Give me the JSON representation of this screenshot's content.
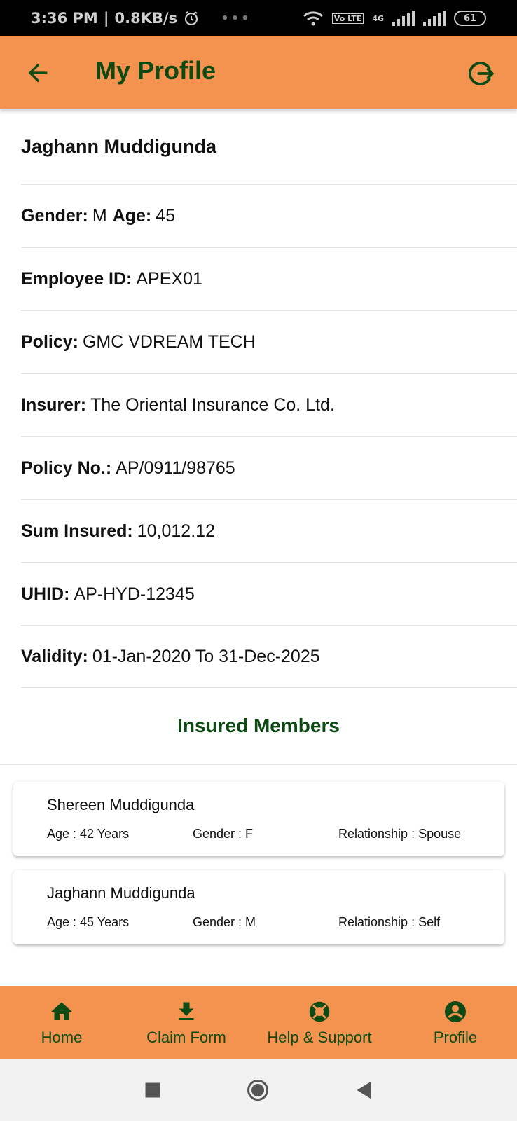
{
  "status_bar": {
    "time": "3:36 PM",
    "speed": "0.8KB/s",
    "network_tags": [
      "Vo LTE",
      "4G"
    ],
    "battery": "61"
  },
  "header": {
    "title": "My Profile",
    "back_icon": "back-arrow-icon",
    "logout_icon": "logout-icon"
  },
  "profile": {
    "name": "Jaghann Muddigunda",
    "gender_label": "Gender:",
    "gender_value": "M",
    "age_label": "Age:",
    "age_value": "45",
    "employee_id_label": "Employee ID:",
    "employee_id_value": "APEX01",
    "policy_label": "Policy:",
    "policy_value": "GMC VDREAM TECH",
    "insurer_label": "Insurer:",
    "insurer_value": "The Oriental Insurance Co. Ltd.",
    "policy_no_label": "Policy No.:",
    "policy_no_value": "AP/0911/98765",
    "sum_insured_label": "Sum Insured:",
    "sum_insured_value": "10,012.12",
    "uhid_label": "UHID:",
    "uhid_value": "AP-HYD-12345",
    "validity_label": "Validity:",
    "validity_value": "01-Jan-2020 To 31-Dec-2025"
  },
  "insured_members": {
    "title": "Insured Members",
    "members": [
      {
        "name": "Shereen Muddigunda",
        "age": "Age : 42 Years",
        "gender": "Gender : F",
        "relationship": "Relationship : Spouse"
      },
      {
        "name": "Jaghann Muddigunda",
        "age": "Age : 45 Years",
        "gender": "Gender : M",
        "relationship": "Relationship : Self"
      }
    ]
  },
  "bottom_nav": {
    "items": [
      {
        "label": "Home",
        "icon": "home-icon"
      },
      {
        "label": "Claim Form",
        "icon": "download-icon"
      },
      {
        "label": "Help & Support",
        "icon": "support-icon"
      },
      {
        "label": "Profile",
        "icon": "account-circle-icon"
      }
    ]
  },
  "colors": {
    "accent": "#f4924f",
    "primary_text": "#0d4a14"
  }
}
